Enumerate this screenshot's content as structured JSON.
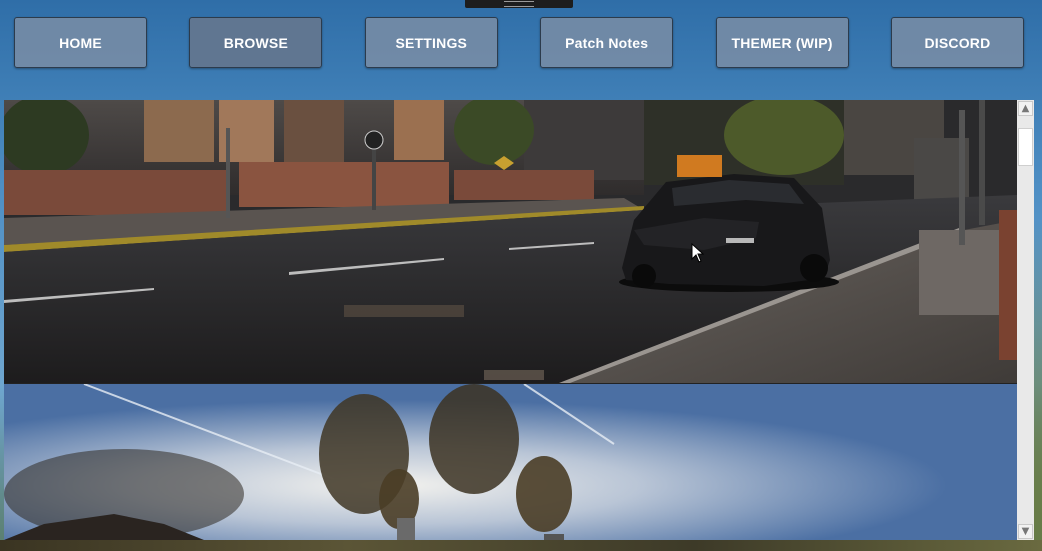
{
  "nav": {
    "items": [
      {
        "label": "HOME"
      },
      {
        "label": "BROWSE"
      },
      {
        "label": "SETTINGS"
      },
      {
        "label": "Patch Notes"
      },
      {
        "label": "THEMER (WIP)"
      },
      {
        "label": "DISCORD"
      }
    ],
    "active_index": 1
  },
  "gallery": {
    "images": [
      {
        "subject": "street-scene-dark-hatchback"
      },
      {
        "subject": "sky-smokestacks"
      }
    ]
  },
  "icons": {
    "scroll_up": "arrow-up-icon",
    "scroll_down": "arrow-down-icon",
    "cursor": "mouse-pointer-icon"
  },
  "colors": {
    "button_bg": "#7a8ca4",
    "button_text": "#ffffff",
    "page_bg": "#4f8fc4"
  }
}
